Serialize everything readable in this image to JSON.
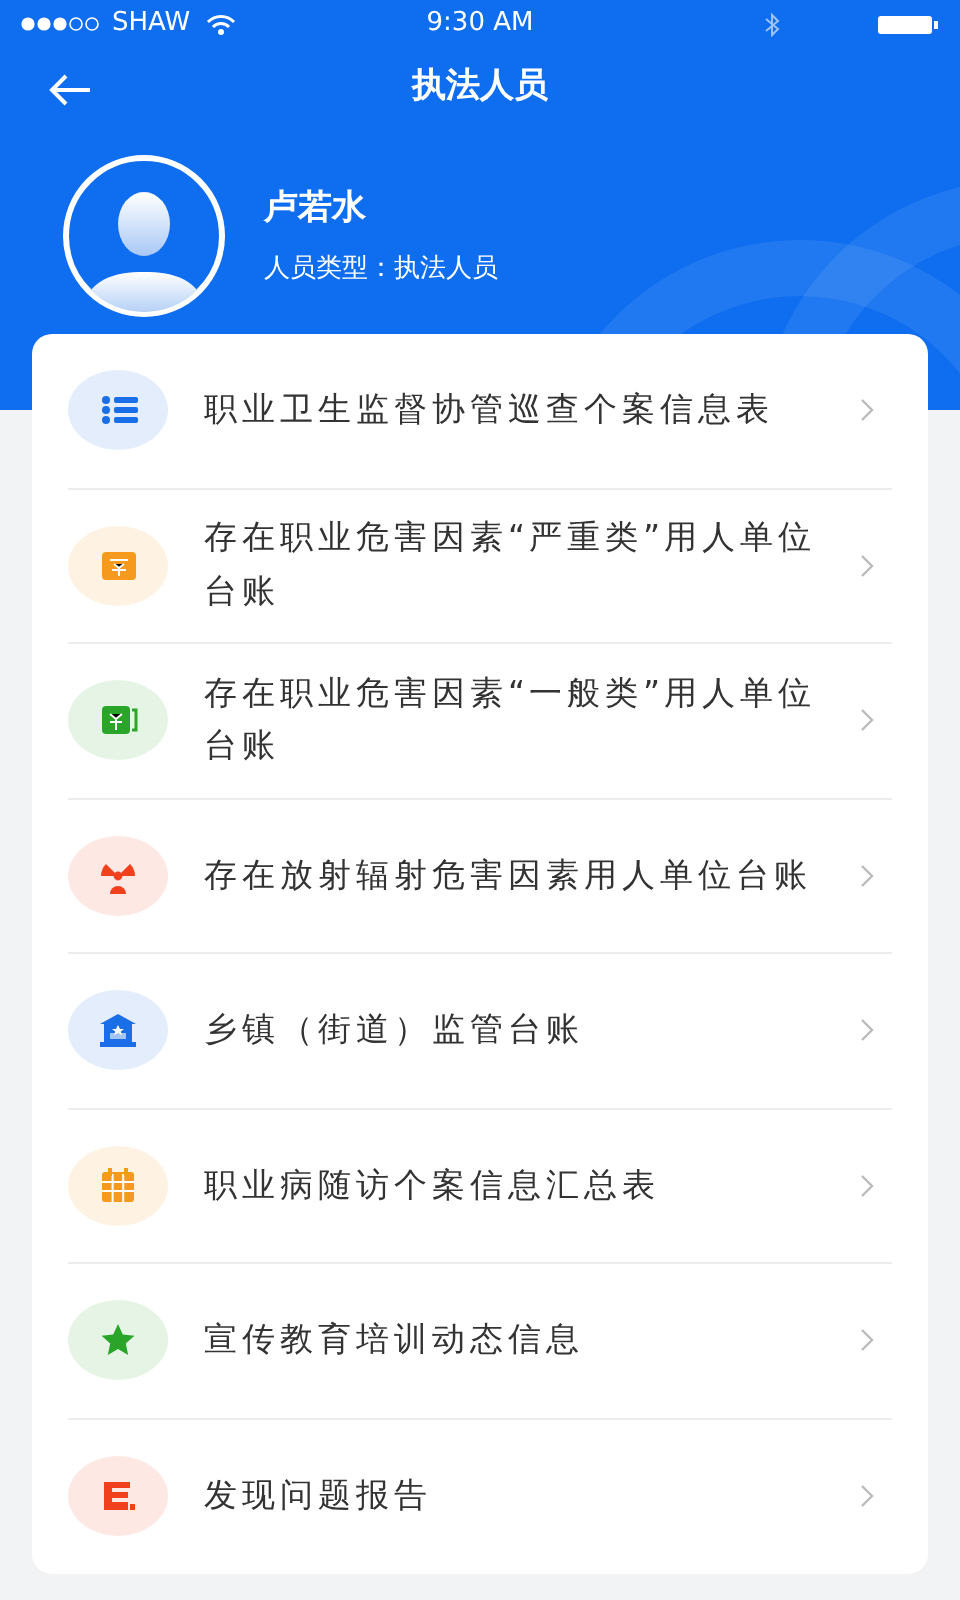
{
  "status_bar": {
    "carrier": "SHAW",
    "time": "9:30 AM"
  },
  "header": {
    "title": "执法人员"
  },
  "profile": {
    "name": "卢若水",
    "type_label": "人员类型：执法人员"
  },
  "menu": [
    {
      "label": "职业卫生监督协管巡查个案信息表",
      "kind": "list",
      "color": "#1a6fe8"
    },
    {
      "label": "存在职业危害因素“严重类”用人单位台账",
      "kind": "money",
      "color": "#f59a1c"
    },
    {
      "label": "存在职业危害因素“一般类”用人单位台账",
      "kind": "wallet",
      "color": "#2aa52a"
    },
    {
      "label": "存在放射辐射危害因素用人单位台账",
      "kind": "radiation",
      "color": "#f0401e"
    },
    {
      "label": "乡镇（街道）监管台账",
      "kind": "building",
      "color": "#1a6fe8"
    },
    {
      "label": "职业病随访个案信息汇总表",
      "kind": "calendar",
      "color": "#f59a1c"
    },
    {
      "label": "宣传教育培训动态信息",
      "kind": "star",
      "color": "#2aa52a"
    },
    {
      "label": "发现问题报告",
      "kind": "report",
      "color": "#f0401e"
    }
  ]
}
